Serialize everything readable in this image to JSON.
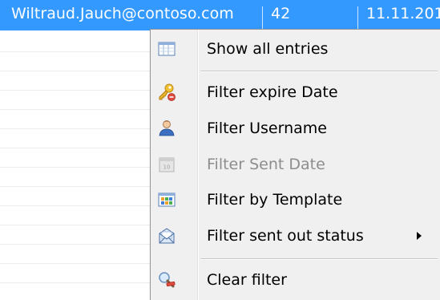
{
  "grid": {
    "selected_row": {
      "email": "Wiltraud.Jauch@contoso.com",
      "count": "42",
      "date": "11.11.201"
    }
  },
  "context_menu": {
    "items": [
      {
        "label": "Show all entries",
        "icon": "list-icon",
        "enabled": true
      },
      {
        "label": "Filter expire Date",
        "icon": "key-icon",
        "enabled": true
      },
      {
        "label": "Filter Username",
        "icon": "user-icon",
        "enabled": true
      },
      {
        "label": "Filter Sent Date",
        "icon": "calendar-icon",
        "enabled": false
      },
      {
        "label": "Filter by Template",
        "icon": "template-icon",
        "enabled": true
      },
      {
        "label": "Filter sent out status",
        "icon": "envelope-icon",
        "enabled": true,
        "submenu": true
      },
      {
        "label": "Clear filter",
        "icon": "clear-filter-icon",
        "enabled": true
      }
    ]
  },
  "colors": {
    "selection": "#3399ff",
    "menu_bg": "#f0f0f0",
    "disabled_text": "#8d8d8d"
  }
}
